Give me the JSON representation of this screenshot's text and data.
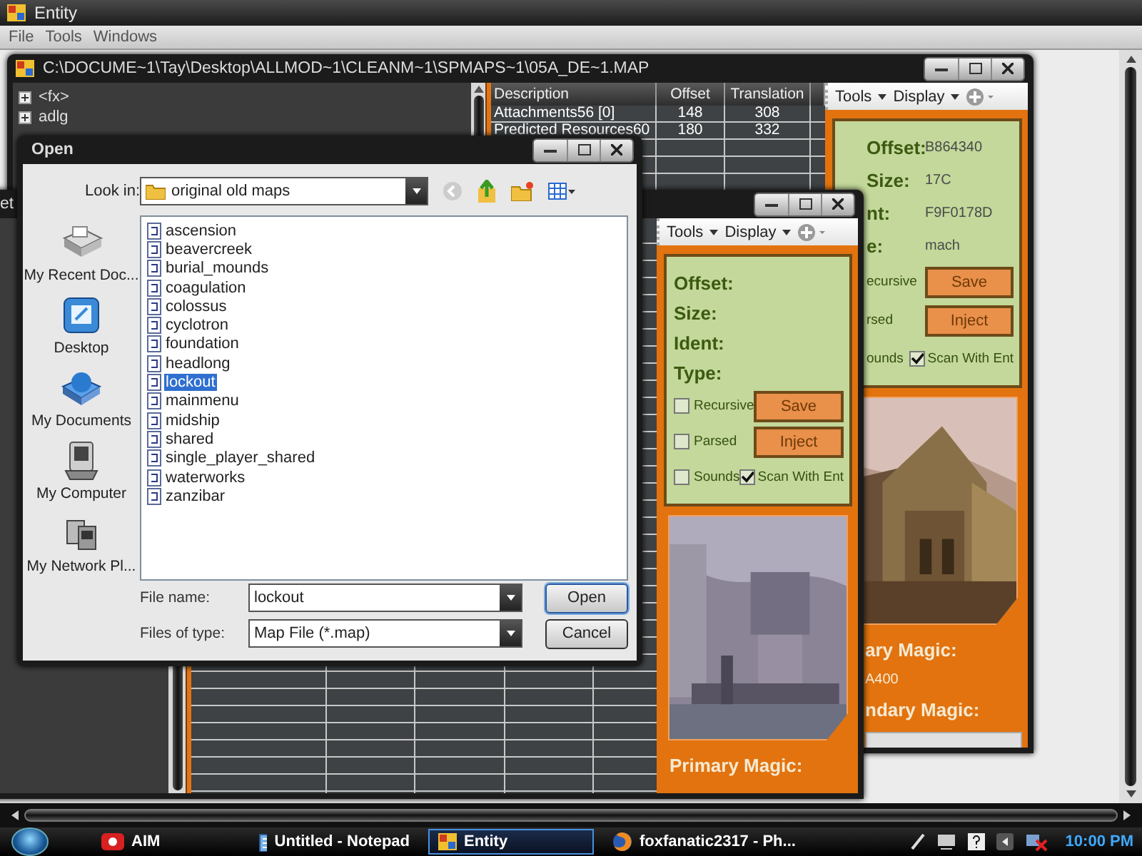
{
  "app": {
    "title": "Entity",
    "menu": [
      "File",
      "Tools",
      "Windows"
    ]
  },
  "map_windows": [
    {
      "title": "C:\\DOCUME~1\\Tay\\Desktop\\ALLMOD~1\\CLEANM~1\\SPMAPS~1\\05A_DE~1.MAP",
      "tree": [
        {
          "label": "<fx>"
        },
        {
          "label": "adlg"
        }
      ],
      "grid": {
        "columns": [
          "Description",
          "Offset",
          "Translation"
        ],
        "rows": [
          [
            "Attachments56 [0]",
            "148",
            "308"
          ],
          [
            "Predicted Resources60",
            "180",
            "332"
          ]
        ]
      },
      "panel": {
        "menus": [
          "Tools",
          "Display"
        ],
        "fields": [
          {
            "label": "Offset:",
            "value": "B864340"
          },
          {
            "label": "Size:",
            "value": "17C"
          },
          {
            "label": "nt:",
            "value": "F9F0178D"
          },
          {
            "label": "e:",
            "value": "mach"
          }
        ],
        "options": [
          {
            "label": "ecursive"
          },
          {
            "label": "rsed"
          },
          {
            "label": "ounds"
          }
        ],
        "buttons": [
          "Save",
          "Inject"
        ],
        "scan": {
          "label": "Scan With Ent",
          "checked": true
        },
        "picture": {
          "kind": "picture"
        },
        "magic": [
          {
            "label": "ary Magic:",
            "value": "A400"
          },
          {
            "label": "ndary Magic:"
          }
        ],
        "entry_field": true
      }
    },
    {
      "title": "et",
      "panel": {
        "menus": [
          "Tools",
          "Display"
        ],
        "fields": [
          {
            "label": "Offset:"
          },
          {
            "label": "Size:"
          },
          {
            "label": "Ident:"
          },
          {
            "label": "Type:"
          }
        ],
        "options": [
          {
            "label": "Recursive",
            "checked": false
          },
          {
            "label": "Parsed",
            "checked": false
          },
          {
            "label": "Sounds",
            "checked": false
          }
        ],
        "buttons": [
          "Save",
          "Inject"
        ],
        "scan": {
          "label": "Scan With Ent",
          "checked": true
        },
        "picture": {
          "kind": "picture"
        },
        "magic": [
          {
            "label": "Primary Magic:"
          }
        ]
      }
    }
  ],
  "dialog": {
    "title": "Open",
    "look_in": {
      "label": "Look in:",
      "value": "original old maps"
    },
    "places": [
      {
        "label": "My Recent Doc...",
        "kind": "recent"
      },
      {
        "label": "Desktop",
        "kind": "desktop"
      },
      {
        "label": "My Documents",
        "kind": "documents"
      },
      {
        "label": "My Computer",
        "kind": "computer"
      },
      {
        "label": "My Network Pl...",
        "kind": "network"
      }
    ],
    "files": [
      {
        "name": "ascension",
        "selected": false
      },
      {
        "name": "beavercreek",
        "selected": false
      },
      {
        "name": "burial_mounds",
        "selected": false
      },
      {
        "name": "coagulation",
        "selected": false
      },
      {
        "name": "colossus",
        "selected": false
      },
      {
        "name": "cyclotron",
        "selected": false
      },
      {
        "name": "foundation",
        "selected": false
      },
      {
        "name": "headlong",
        "selected": false
      },
      {
        "name": "lockout",
        "selected": true
      },
      {
        "name": "mainmenu",
        "selected": false
      },
      {
        "name": "midship",
        "selected": false
      },
      {
        "name": "shared",
        "selected": false
      },
      {
        "name": "single_player_shared",
        "selected": false
      },
      {
        "name": "waterworks",
        "selected": false
      },
      {
        "name": "zanzibar",
        "selected": false
      }
    ],
    "file_name": {
      "label": "File name:",
      "value": "lockout"
    },
    "file_type": {
      "label": "Files of type:",
      "value": "Map File (*.map)"
    },
    "buttons": [
      "Open",
      "Cancel"
    ]
  },
  "taskbar": {
    "items": [
      {
        "label": "AIM",
        "kind": "aim",
        "selected": false
      },
      {
        "label": "Untitled - Notepad",
        "kind": "notepad",
        "selected": false
      },
      {
        "label": "Entity",
        "kind": "entity",
        "selected": true
      },
      {
        "label": "foxfanatic2317 - Ph...",
        "kind": "browser",
        "selected": false
      }
    ],
    "clock": "10:00 PM"
  }
}
